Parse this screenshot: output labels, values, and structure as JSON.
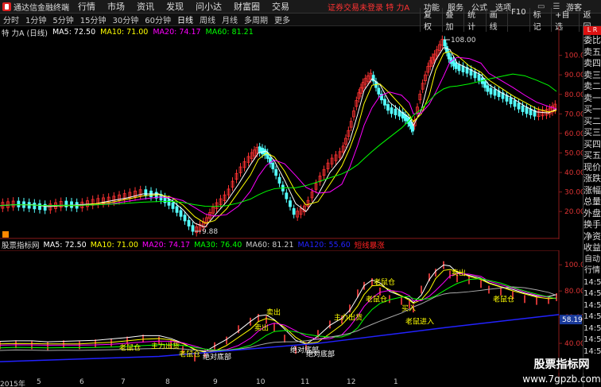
{
  "app": {
    "logo_text": "通达信金融终端"
  },
  "menu": [
    "行情",
    "市场",
    "资讯",
    "发现",
    "问小达",
    "财富圈",
    "交易"
  ],
  "alert": "证券交易未登录",
  "symbol_name": "特 力A",
  "top_right": [
    "功能",
    "服务",
    "公式",
    "选项"
  ],
  "window_controls": [
    "L",
    "R"
  ],
  "guest": "游客",
  "periods": [
    "分时",
    "1分钟",
    "5分钟",
    "15分钟",
    "30分钟",
    "60分钟",
    "日线",
    "周线",
    "月线",
    "多周期",
    "更多"
  ],
  "tools": [
    "复权",
    "叠加",
    "统计",
    "画线",
    "F10",
    "标记",
    "+自选",
    "返回"
  ],
  "price_line": {
    "symbol": "特 力A (日线)",
    "ma5": "MA5: 72.50",
    "ma10": "MA10: 71.00",
    "ma20": "MA20: 74.17",
    "ma60": "MA60: 81.21"
  },
  "price_axis": [
    "100.0",
    "90.00",
    "80.00",
    "70.00",
    "60.00",
    "50.00",
    "40.00",
    "30.00",
    "20.00"
  ],
  "price_annotations": {
    "high": "108.00",
    "low": "9.88"
  },
  "right_panel_top": "L R",
  "right_panel": [
    "委比",
    "卖五",
    "卖四",
    "卖三",
    "卖二",
    "卖一",
    "买一",
    "买二",
    "买三",
    "买四",
    "买五",
    "现价",
    "涨跌",
    "涨幅",
    "总量",
    "外盘",
    "换手",
    "净资",
    "收益",
    "自动",
    "行情",
    "14:5",
    "14:5",
    "14:5",
    "14:5",
    "14:5",
    "14:5",
    "14:5"
  ],
  "indicator_line": {
    "name": "股票指标网",
    "ma5": "MA5: 72.50",
    "ma10": "MA10: 71.00",
    "ma20": "MA20: 74.17",
    "ma30": "MA30: 76.40",
    "ma60": "MA60: 81.21",
    "ma120": "MA120: 55.60",
    "signal": "短线暴涨"
  },
  "ind_axis": [
    "100.0",
    "80.00",
    "60.00",
    "40.00"
  ],
  "ind_marker": "58.19",
  "ind_labels": [
    "卖出",
    "老鼠仓",
    "卖出",
    "老鼠仓",
    "卖出",
    "主力出货",
    "老鼠仓",
    "买入",
    "老鼠仓",
    "老鼠进入",
    "绝对底部",
    "绝对底部",
    "绝对底部",
    "老鼠仓",
    "主力出货"
  ],
  "x_axis": [
    "2015年",
    "5",
    "6",
    "7",
    "8",
    "9",
    "10",
    "11",
    "12",
    "1"
  ],
  "watermark": {
    "line1": "股票指标网",
    "line2": "www.7gpzb.com"
  },
  "colors": {
    "up": "#ff3232",
    "down": "#54ffff",
    "ma5": "#ffffff",
    "ma10": "#ffff00",
    "ma20": "#ff00ff",
    "ma60": "#00ff00",
    "ma120": "#2222ff"
  }
}
